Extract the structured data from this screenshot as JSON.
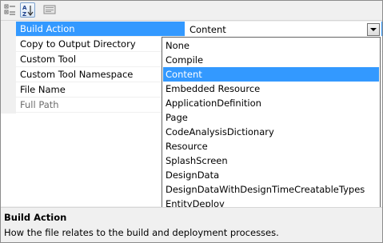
{
  "toolbar": {
    "buttons": [
      {
        "icon": "categorized-icon"
      },
      {
        "icon": "alphabetical-sort-icon",
        "label": "AZ"
      },
      {
        "icon": "property-pages-icon"
      }
    ]
  },
  "properties": [
    {
      "name": "Build Action"
    },
    {
      "name": "Copy to Output Directory"
    },
    {
      "name": "Custom Tool"
    },
    {
      "name": "Custom Tool Namespace"
    },
    {
      "name": "File Name"
    },
    {
      "name": "Full Path"
    }
  ],
  "selected_value": "Content",
  "dropdown": {
    "options": [
      "None",
      "Compile",
      "Content",
      "Embedded Resource",
      "ApplicationDefinition",
      "Page",
      "CodeAnalysisDictionary",
      "Resource",
      "SplashScreen",
      "DesignData",
      "DesignDataWithDesignTimeCreatableTypes",
      "EntityDeploy"
    ],
    "selected": "Content"
  },
  "description": {
    "title": "Build Action",
    "text": "How the file relates to the build and deployment processes."
  },
  "colors": {
    "selection": "#3399ff",
    "panel": "#f0f0f0"
  }
}
